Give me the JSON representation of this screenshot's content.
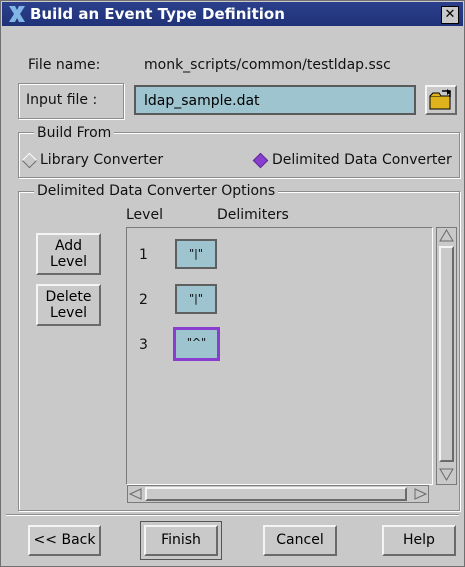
{
  "window": {
    "title": "Build an Event Type Definition",
    "close_glyph": "✕"
  },
  "file_name": {
    "label": "File name:",
    "value": "monk_scripts/common/testldap.ssc"
  },
  "input_file": {
    "label": "Input file :",
    "value": "ldap_sample.dat"
  },
  "build_from": {
    "legend": "Build From",
    "options": [
      {
        "label": "Library Converter",
        "selected": false
      },
      {
        "label": "Delimited Data Converter",
        "selected": true
      }
    ]
  },
  "options_group": {
    "legend": "Delimited Data Converter Options",
    "col_level": "Level",
    "col_delimiters": "Delimiters",
    "add_level": [
      "Add",
      "Level"
    ],
    "delete_level": [
      "Delete",
      "Level"
    ],
    "rows": [
      {
        "level": "1",
        "delimiter": "\"|\""
      },
      {
        "level": "2",
        "delimiter": "\"|\""
      },
      {
        "level": "3",
        "delimiter": "\"^\""
      }
    ]
  },
  "buttons": {
    "back": "<< Back",
    "finish": "Finish",
    "cancel": "Cancel",
    "help": "Help"
  },
  "colors": {
    "title_bar": "#203277",
    "field_bg": "#9ec4cf",
    "selection_accent": "#8a3ed0"
  }
}
